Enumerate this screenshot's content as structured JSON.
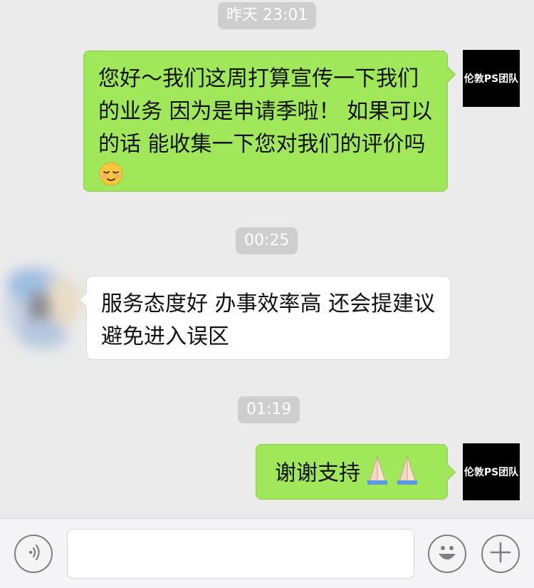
{
  "messages": [
    {
      "type": "timestamp",
      "text": "昨天 23:01"
    },
    {
      "type": "sent",
      "text": "您好～我们这周打算宣传一下我们的业务 因为是申请季啦！ 如果可以的话 能收集一下您对我们的评价吗",
      "emoji": "relieved-face-emoji"
    },
    {
      "type": "timestamp",
      "text": "00:25"
    },
    {
      "type": "received",
      "text": "服务态度好 办事效率高 还会提建议避免进入误区"
    },
    {
      "type": "timestamp",
      "text": "01:19"
    },
    {
      "type": "sent",
      "text": "谢谢支持",
      "emoji": "folded-hands-emoji"
    }
  ],
  "self_avatar": {
    "label": "伦敦PS团队"
  },
  "input_bar": {
    "placeholder": "",
    "voice_icon": "voice-icon",
    "emoji_icon": "emoji-icon",
    "more_icon": "plus-icon"
  },
  "colors": {
    "sent_bubble": "#a0e75a",
    "received_bubble": "#ffffff",
    "background": "#ebebeb",
    "timestamp_bg": "#cecece"
  }
}
